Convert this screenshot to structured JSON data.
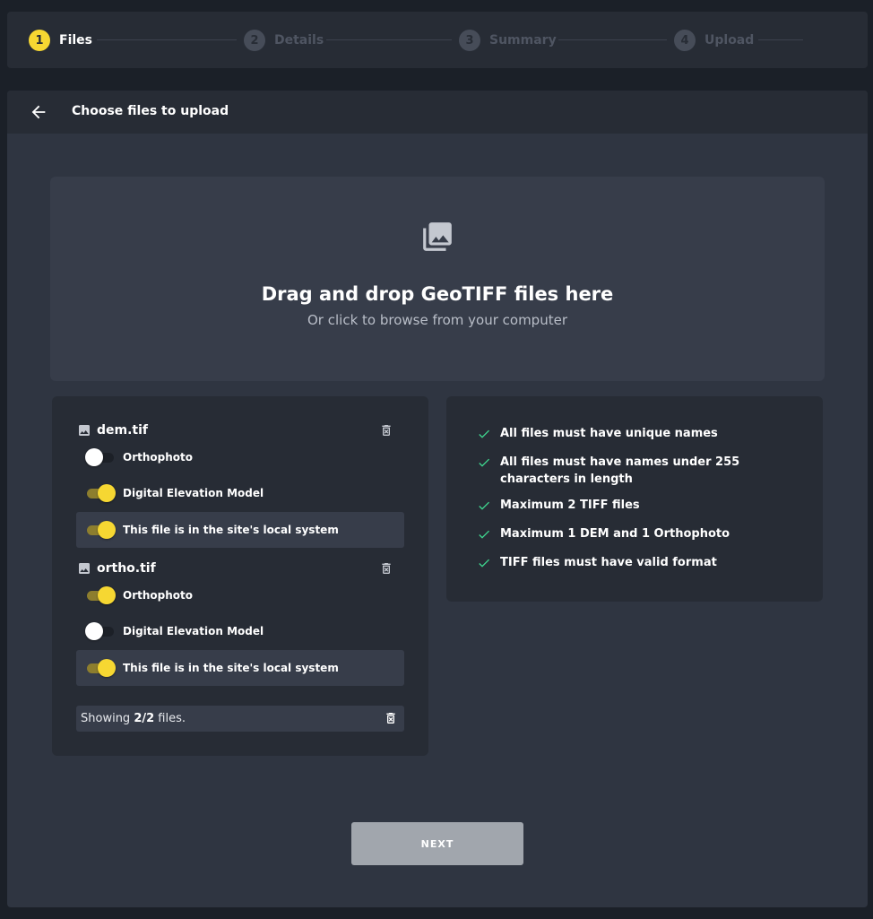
{
  "stepper": {
    "steps": [
      {
        "num": "1",
        "label": "Files"
      },
      {
        "num": "2",
        "label": "Details"
      },
      {
        "num": "3",
        "label": "Summary"
      },
      {
        "num": "4",
        "label": "Upload"
      }
    ],
    "active_step": 1
  },
  "header": {
    "title": "Choose files to upload"
  },
  "dropzone": {
    "title": "Drag and drop GeoTIFF files here",
    "subtitle": "Or click to browse from your computer"
  },
  "files": [
    {
      "name": "dem.tif",
      "orthophoto_label": "Orthophoto",
      "orthophoto_on": false,
      "dem_label": "Digital Elevation Model",
      "dem_on": true,
      "local_label": "This file is in the site's local system",
      "local_on": true
    },
    {
      "name": "ortho.tif",
      "orthophoto_label": "Orthophoto",
      "orthophoto_on": true,
      "dem_label": "Digital Elevation Model",
      "dem_on": false,
      "local_label": "This file is in the site's local system",
      "local_on": true
    }
  ],
  "footer": {
    "prefix": "Showing ",
    "count": "2/2",
    "suffix": " files."
  },
  "rules": [
    "All files must have unique names",
    "All files must have names under 255 characters in length",
    "Maximum 2 TIFF files",
    "Maximum 1 DEM and 1 Orthophoto",
    "TIFF files must have valid format"
  ],
  "next_button": {
    "label": "NEXT"
  },
  "colors": {
    "accent": "#f6d732",
    "check": "#3fd68f",
    "background": "#1b2028",
    "panel": "#2f3541",
    "card": "#272c35"
  }
}
